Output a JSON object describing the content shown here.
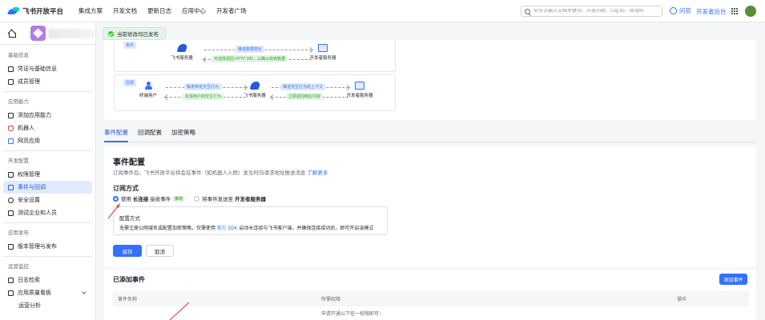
{
  "topnav": {
    "logo_text": "飞书开放平台",
    "items": [
      "集成方案",
      "开发文档",
      "更新日志",
      "应用中心",
      "开发者广场"
    ],
    "search_placeholder": "你可以输入文档关键词、开放问题、Log ID、错误码",
    "ask_label": "问答",
    "console_label": "开发者后台"
  },
  "toast": {
    "text": "当前修改均已发布"
  },
  "sidebar": {
    "sections": [
      {
        "title": "基础信息",
        "items": [
          "凭证与基础信息",
          "成员管理"
        ]
      },
      {
        "title": "应用能力",
        "items": [
          "添加应用能力",
          "机器人",
          "网页应用"
        ]
      },
      {
        "title": "开发配置",
        "items": [
          "权限管理",
          "事件与回调",
          "安全设置",
          "测试企业和人员"
        ]
      },
      {
        "title": "应用发布",
        "items": [
          "版本管理与发布"
        ]
      },
      {
        "title": "运营监控",
        "items": [
          "日志检索",
          "应用质量看板",
          "运营分析"
        ]
      }
    ],
    "active_item": "事件与回调"
  },
  "diagram": {
    "box1": {
      "tag": "事件",
      "node_left": "飞书服务器",
      "node_right": "开发者服务器",
      "arrow_top": "推送数据变化",
      "arrow_bottom": "可选择返回 HTTP 200，以确认收到数据"
    },
    "box2": {
      "tag": "回调",
      "node_left": "终端用户",
      "node_mid": "飞书服务器",
      "node_right": "开发者服务器",
      "arrow1_top": "触发特定交互行为",
      "arrow1_bottom": "反馈用户的交互行为",
      "arrow2_top": "推送交互行为的上下文",
      "arrow2_bottom": "立即返回响应内容"
    }
  },
  "tabs": [
    "事件配置",
    "回调配置",
    "加密策略"
  ],
  "event_config": {
    "title": "事件配置",
    "desc": "订阅事件后，飞书开放平台将会在事件（如机器人入群）发生时向请求地址推送消息",
    "desc_link": "了解更多",
    "sub_title": "订阅方式",
    "option1_prefix": "使用 ",
    "option1_bold": "长连接",
    "option1_suffix": " 接收事件",
    "option1_badge": "推荐",
    "option2_prefix": "将事件发送至 ",
    "option2_bold": "开发者服务器",
    "config_title": "配置方式",
    "config_text_before": "无需注册公网域名或配置加密策略，仅需使用 ",
    "config_link": "官方 SDK",
    "config_text_after": " 启动长连接与飞书客户端，并确保连接成功后，即可开启该模式",
    "save_label": "保存",
    "cancel_label": "取消"
  },
  "events": {
    "title": "已添加事件",
    "add_label": "添加事件",
    "columns": [
      "事件名称",
      "所需权限",
      "操作"
    ],
    "row_hint": "申请开通以下任一权限即可："
  },
  "colors": {
    "accent": "#3370ff",
    "annotation": "#d83931"
  }
}
